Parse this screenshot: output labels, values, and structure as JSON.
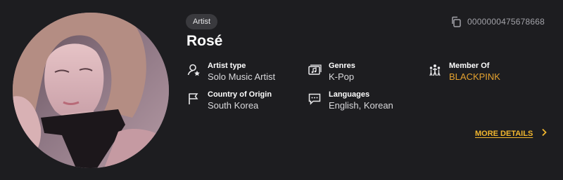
{
  "artist": {
    "badge": "Artist",
    "name": "Rosé",
    "id": "0000000475678668"
  },
  "fields": [
    {
      "label": "Artist type",
      "value": "Solo Music Artist",
      "icon": "person-badge-icon"
    },
    {
      "label": "Genres",
      "value": "K-Pop",
      "icon": "music-library-icon"
    },
    {
      "label": "Member Of",
      "value": "BLACKPINK",
      "icon": "group-icon"
    },
    {
      "label": "Country of Origin",
      "value": "South Korea",
      "icon": "flag-icon"
    },
    {
      "label": "Languages",
      "value": "English, Korean",
      "icon": "speech-bubble-icon"
    }
  ],
  "more_details": "MORE DETAILS",
  "colors": {
    "background": "#1d1d20",
    "accent": "#f1b62e",
    "link": "#e3a12f"
  }
}
